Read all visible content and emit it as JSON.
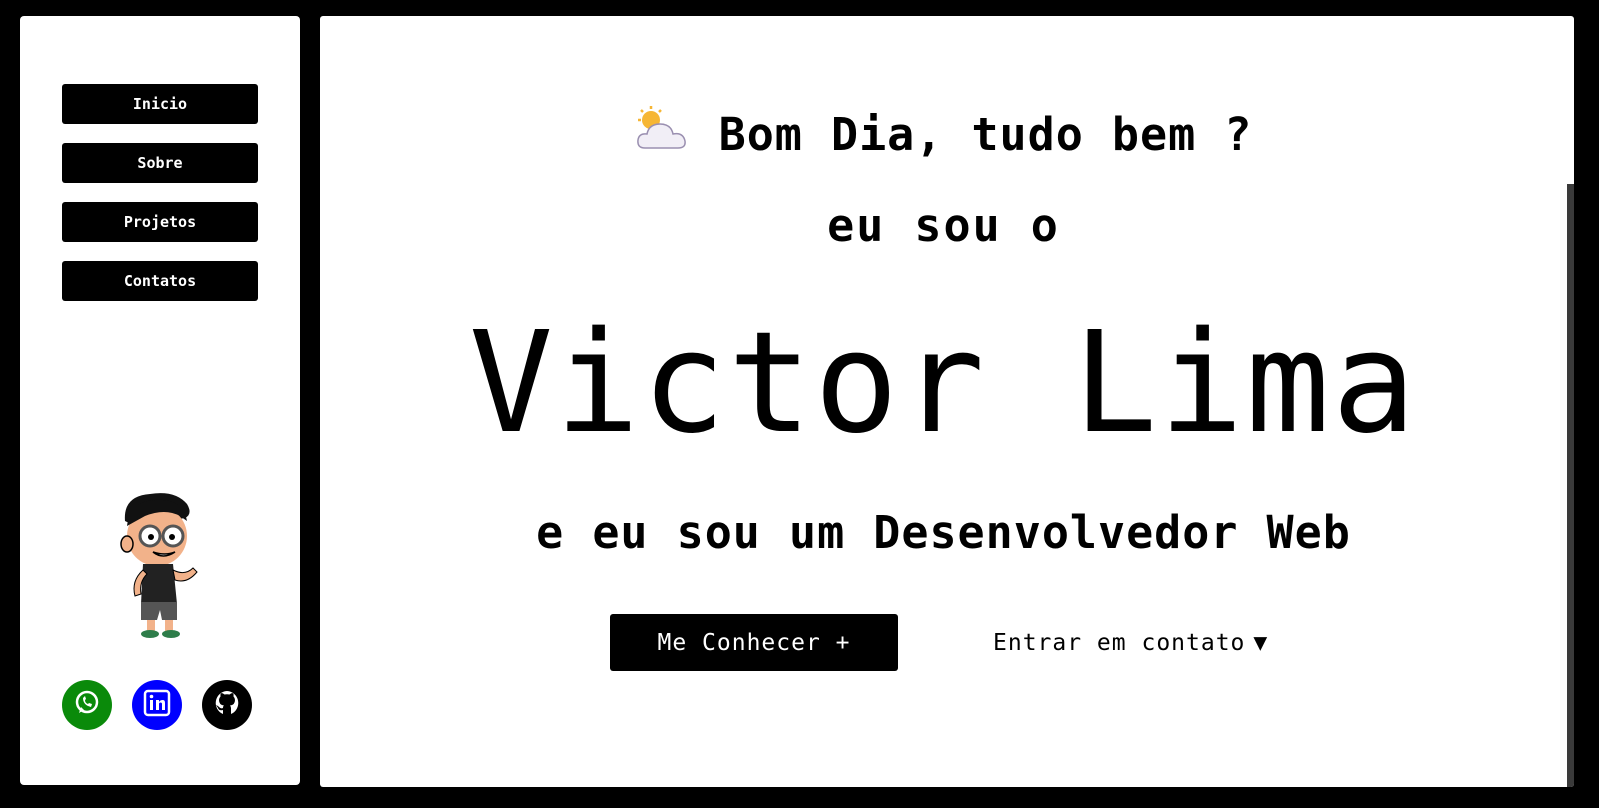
{
  "sidebar": {
    "nav": [
      {
        "label": "Inicio"
      },
      {
        "label": "Sobre"
      },
      {
        "label": "Projetos"
      },
      {
        "label": "Contatos"
      }
    ],
    "social": [
      {
        "icon": "whatsapp-icon",
        "color": "#0a8a0a"
      },
      {
        "icon": "linkedin-icon",
        "color": "#0000ff"
      },
      {
        "icon": "github-icon",
        "color": "#000000"
      }
    ]
  },
  "hero": {
    "weather_icon": "sun-behind-cloud-icon",
    "greeting": "Bom Dia, tudo bem ?",
    "intro": "eu sou o",
    "name": "Victor Lima",
    "role": "e eu sou um Desenvolvedor Web",
    "cta_label": "Me Conhecer +",
    "contact_label": "Entrar em contato",
    "contact_arrow": "▼"
  }
}
